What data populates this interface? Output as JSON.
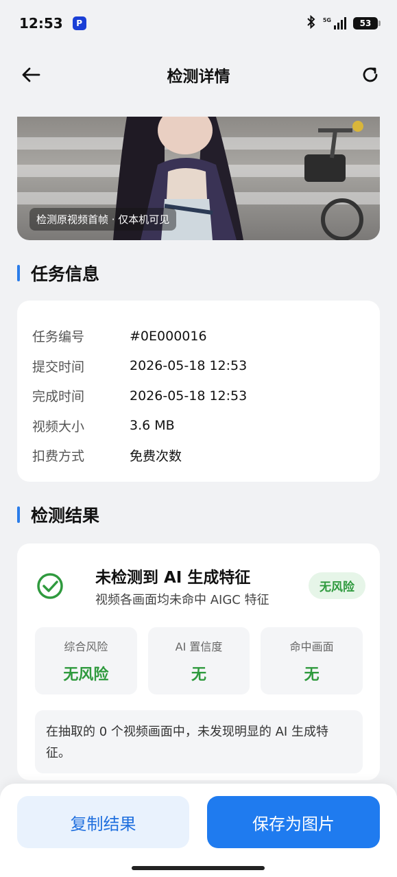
{
  "status_bar": {
    "time": "12:53",
    "network": "5G",
    "battery": "53"
  },
  "nav": {
    "title": "检测详情"
  },
  "frame": {
    "caption": "检测原视频首帧 · 仅本机可见"
  },
  "task_section": {
    "title": "任务信息",
    "rows": [
      {
        "key": "任务编号",
        "value": "#0E000016"
      },
      {
        "key": "提交时间",
        "value": "2026-05-18 12:53"
      },
      {
        "key": "完成时间",
        "value": "2026-05-18 12:53"
      },
      {
        "key": "视频大小",
        "value": "3.6 MB"
      },
      {
        "key": "扣费方式",
        "value": "免费次数"
      }
    ]
  },
  "result_section": {
    "title": "检测结果",
    "headline": "未检测到 AI 生成特征",
    "subline": "视频各画面均未命中 AIGC 特征",
    "badge": "无风险",
    "metrics": [
      {
        "label": "综合风险",
        "value": "无风险"
      },
      {
        "label": "AI 置信度",
        "value": "无"
      },
      {
        "label": "命中画面",
        "value": "无"
      }
    ],
    "summary": "在抽取的 0 个视频画面中，未发现明显的 AI 生成特征。"
  },
  "actions": {
    "copy_label": "复制结果",
    "save_label": "保存为图片"
  },
  "colors": {
    "accent": "#2b7de9",
    "primary_button": "#1f7bef",
    "safe_green": "#2f9a3e"
  }
}
